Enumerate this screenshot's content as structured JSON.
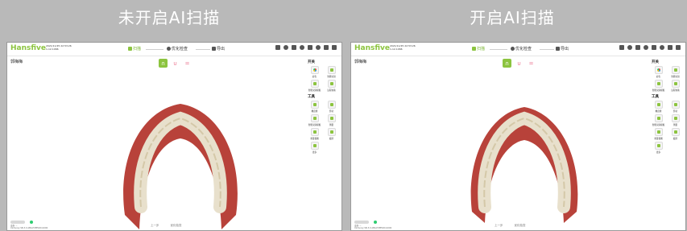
{
  "captions": {
    "left": "未开启AI扫描",
    "right": "开启AI扫描"
  },
  "app": {
    "logo": "Hansfive",
    "datetime": "2021/11/25 22:53:26",
    "sub_id": "1-12-1066",
    "steps": [
      {
        "label": "扫描",
        "active": true
      },
      {
        "label": "优化检查",
        "active": false
      },
      {
        "label": "导出",
        "active": false
      }
    ],
    "patient_name": "郭梅梅",
    "jaw_options": [
      {
        "icon": "∩",
        "active": true
      },
      {
        "icon": "∪",
        "active": false
      },
      {
        "icon": "=",
        "active": false
      }
    ],
    "toolbar_icons": [
      "save-icon",
      "target-icon",
      "grid-icon",
      "help-icon",
      "wand-icon",
      "settings-icon",
      "window-icon",
      "close-icon"
    ],
    "sections": {
      "switch_title": "开关",
      "switch_items": [
        "彩色",
        "智能切割",
        "智能识别模板",
        "远程协助"
      ],
      "tools_title": "工具",
      "tool_items": [
        "橡皮擦",
        "剪切",
        "智能识别模板",
        "测量",
        "重置视图",
        "截屏",
        "更多"
      ]
    },
    "bottom": {
      "device_label": "设备: --",
      "device_id": "Xinhuoxy SN 3.0 AB1A5HP5CDx1000",
      "prev": "上一步",
      "next": "优化检查"
    }
  }
}
